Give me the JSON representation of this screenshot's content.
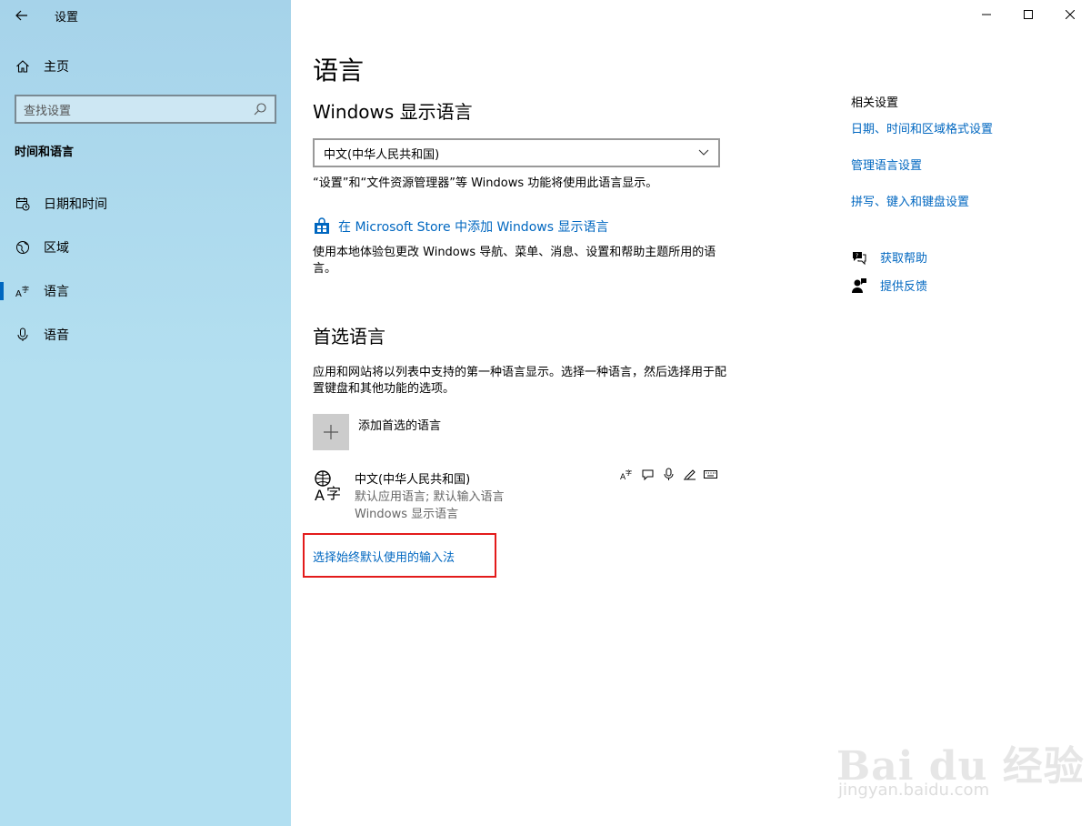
{
  "sidebar": {
    "app_title": "设置",
    "home_label": "主页",
    "search_placeholder": "查找设置",
    "section_title": "时间和语言",
    "items": [
      {
        "label": "日期和时间"
      },
      {
        "label": "区域"
      },
      {
        "label": "语言",
        "active": true
      },
      {
        "label": "语音"
      }
    ]
  },
  "main": {
    "page_title": "语言",
    "display_lang_heading": "Windows 显示语言",
    "display_lang_value": "中文(中华人民共和国)",
    "display_lang_desc": "“设置”和“文件资源管理器”等 Windows 功能将使用此语言显示。",
    "store_link": "在 Microsoft Store 中添加 Windows 显示语言",
    "store_desc": "使用本地体验包更改 Windows 导航、菜单、消息、设置和帮助主题所用的语言。",
    "preferred_heading": "首选语言",
    "preferred_desc": "应用和网站将以列表中支持的第一种语言显示。选择一种语言，然后选择用于配置键盘和其他功能的选项。",
    "add_language_label": "添加首选的语言",
    "language_item": {
      "name": "中文(中华人民共和国)",
      "sub1": "默认应用语言; 默认输入语言",
      "sub2": "Windows 显示语言"
    },
    "ime_link": "选择始终默认使用的输入法"
  },
  "related": {
    "title": "相关设置",
    "links": [
      "日期、时间和区域格式设置",
      "管理语言设置",
      "拼写、键入和键盘设置"
    ],
    "help": "获取帮助",
    "feedback": "提供反馈"
  },
  "watermark": {
    "main": "Bai du 经验",
    "sub": "jingyan.baidu.com"
  },
  "colors": {
    "accent": "#0067c0",
    "highlight_box": "#e31b1b",
    "sidebar_bg": "#b2dff1"
  }
}
